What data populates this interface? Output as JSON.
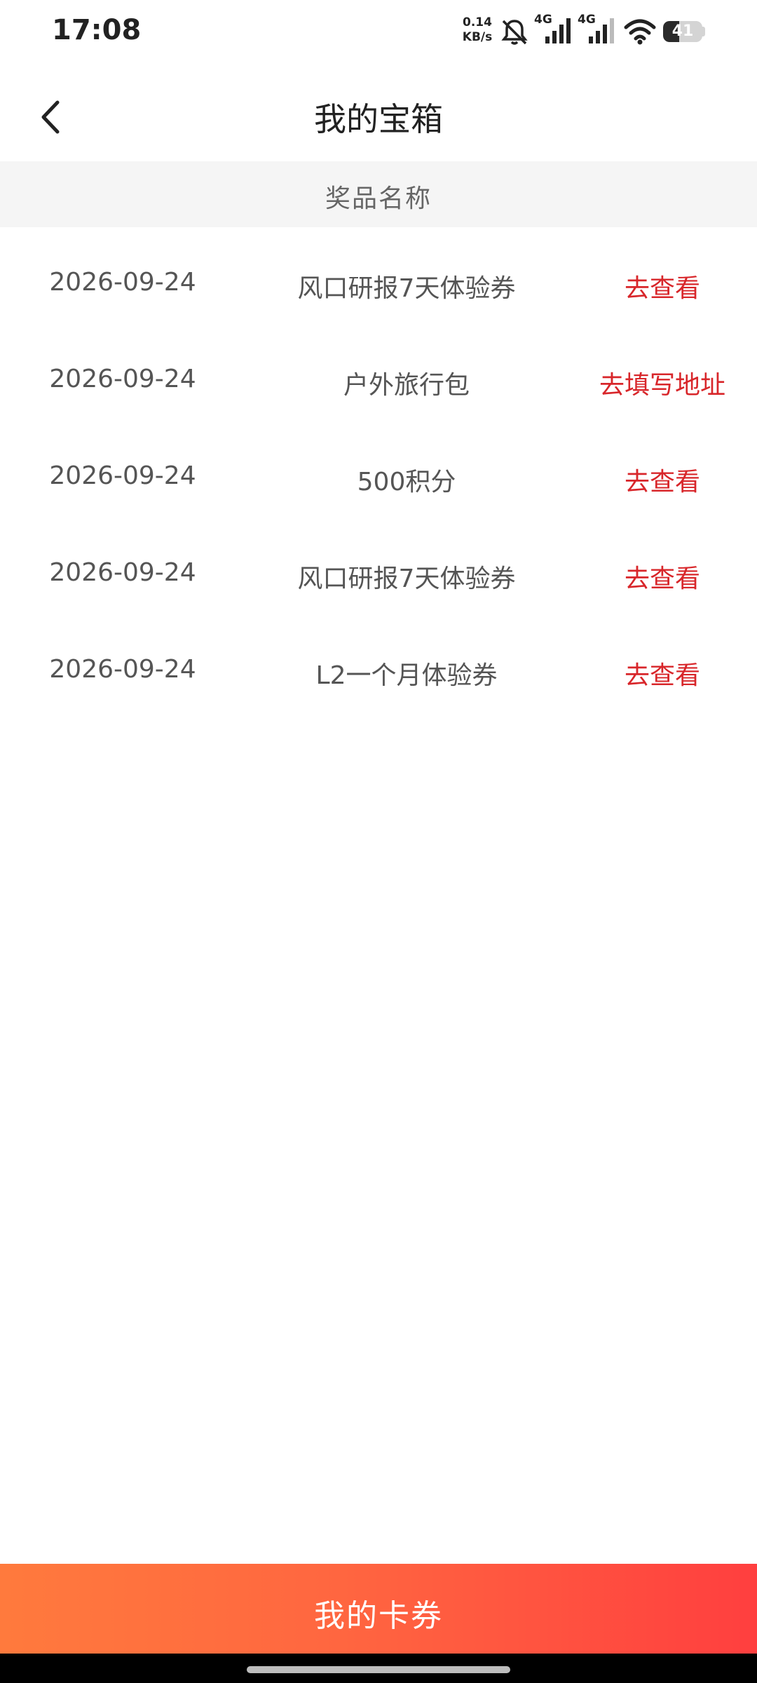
{
  "status_bar": {
    "time": "17:08",
    "net_speed_value": "0.14",
    "net_speed_unit": "KB/s",
    "signal1_label": "4G",
    "signal2_label": "4G",
    "battery_level": "41",
    "icons": [
      "mute-bell-icon",
      "signal-icon",
      "signal-icon",
      "wifi-icon",
      "battery-icon"
    ]
  },
  "header": {
    "title": "我的宝箱",
    "back_icon": "chevron-left-icon"
  },
  "table": {
    "column_header": "奖品名称",
    "rows": [
      {
        "date": "2026-09-24",
        "prize": "风口研报7天体验券",
        "action": "去查看"
      },
      {
        "date": "2026-09-24",
        "prize": "户外旅行包",
        "action": "去填写地址"
      },
      {
        "date": "2026-09-24",
        "prize": "500积分",
        "action": "去查看"
      },
      {
        "date": "2026-09-24",
        "prize": "风口研报7天体验券",
        "action": "去查看"
      },
      {
        "date": "2026-09-24",
        "prize": "L2一个月体验券",
        "action": "去查看"
      }
    ]
  },
  "footer": {
    "button_label": "我的卡券"
  },
  "colors": {
    "action_red": "#d8262a",
    "button_gradient_start": "#ff7a3d",
    "button_gradient_end": "#ff3f3f"
  }
}
